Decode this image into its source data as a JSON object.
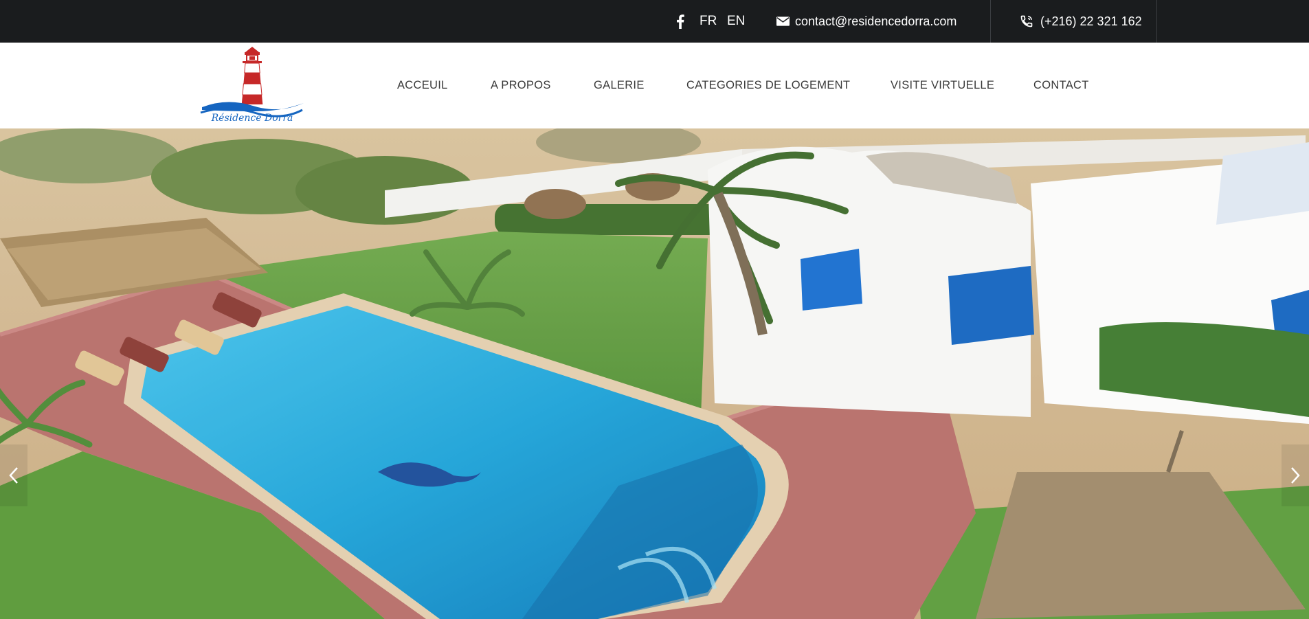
{
  "topbar": {
    "facebook_icon": "facebook-icon",
    "languages": [
      "FR",
      "EN"
    ],
    "email_icon": "envelope-icon",
    "email": "contact@residencedorra.com",
    "phone_icon": "phone-icon",
    "phone": "(+216) 22 321 162"
  },
  "logo": {
    "name": "Résidence Dorra",
    "brand_colors": [
      "#c62828",
      "#1565c0"
    ]
  },
  "nav": {
    "items": [
      "ACCEUIL",
      "A PROPOS",
      "GALERIE",
      "CATEGORIES DE LOGEMENT",
      "VISITE VIRTUELLE",
      "CONTACT"
    ]
  },
  "hero": {
    "description_icon_left": "chevron-left-icon",
    "description_icon_right": "chevron-right-icon"
  },
  "colors": {
    "topbar_bg": "#1a1c1e",
    "nav_text": "#3a3a3a",
    "pool_blue": "#1ea3d8",
    "shutter_blue": "#1565c0"
  }
}
